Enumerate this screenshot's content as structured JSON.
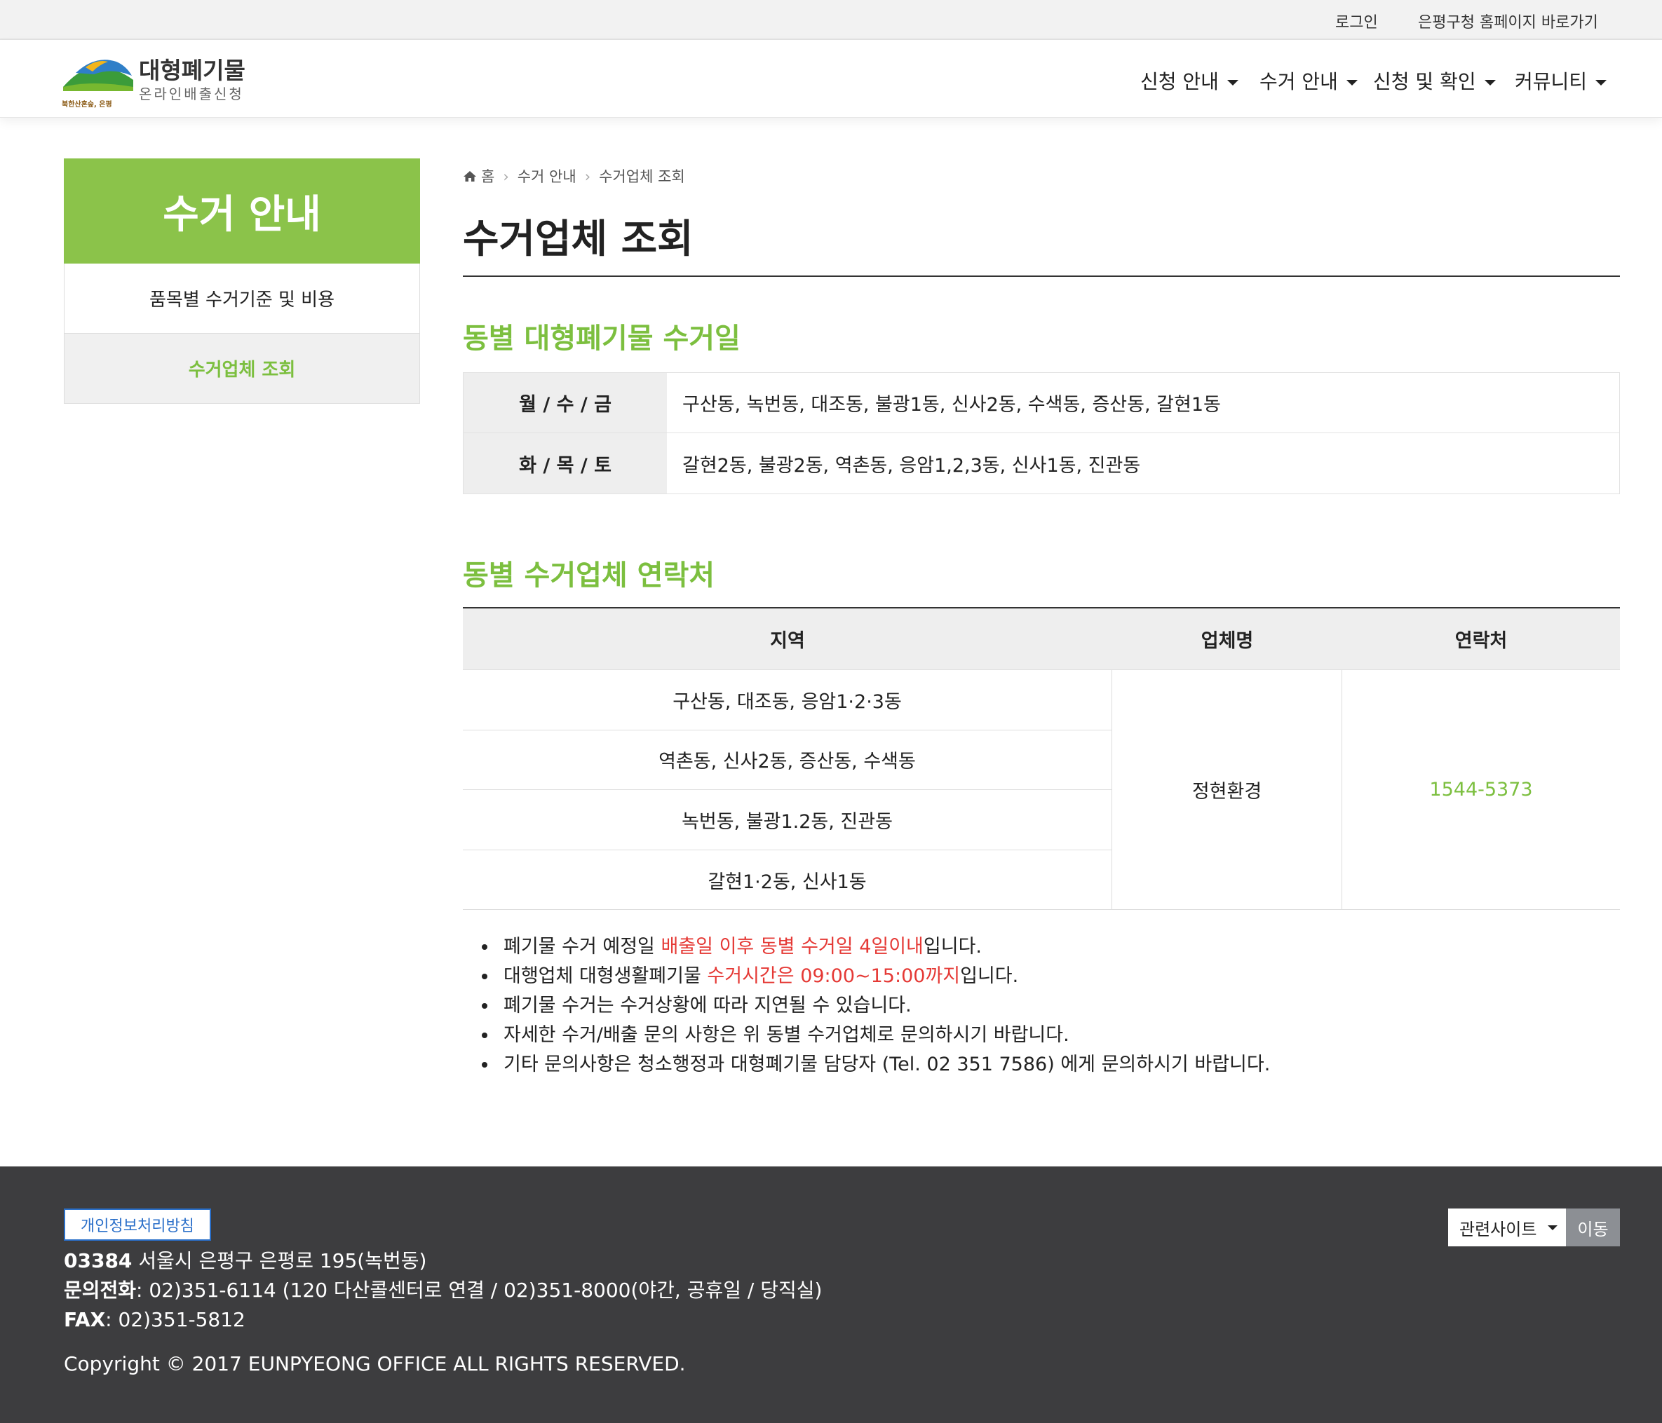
{
  "topbar": {
    "login": "로그인",
    "homepage_link": "은평구청 홈페이지 바로가기"
  },
  "header": {
    "logo_title": "대형폐기물",
    "logo_subtitle": "온라인배출신청",
    "logo_slogan": "북한산혼숲, 은평",
    "nav": [
      "신청 안내",
      "수거 안내",
      "신청 및 확인",
      "커뮤니티"
    ]
  },
  "sidebar": {
    "title": "수거 안내",
    "items": [
      "품목별 수거기준 및 비용",
      "수거업체 조회"
    ]
  },
  "breadcrumb": [
    "홈",
    "수거 안내",
    "수거업체 조회"
  ],
  "page_title": "수거업체 조회",
  "section1": {
    "title": "동별 대형폐기물 수거일",
    "rows": [
      {
        "days": "월 / 수 / 금",
        "areas": "구산동, 녹번동, 대조동, 불광1동, 신사2동, 수색동, 증산동, 갈현1동"
      },
      {
        "days": "화 / 목 / 토",
        "areas": "갈현2동, 불광2동, 역촌동, 응암1,2,3동, 신사1동, 진관동"
      }
    ]
  },
  "section2": {
    "title": "동별 수거업체 연락처",
    "headers": [
      "지역",
      "업체명",
      "연락처"
    ],
    "regions": [
      "구산동, 대조동, 응암1·2·3동",
      "역촌동, 신사2동, 증산동, 수색동",
      "녹번동, 불광1.2동, 진관동",
      "갈현1·2동, 신사1동"
    ],
    "company": "정현환경",
    "phone": "1544-5373"
  },
  "notes": {
    "n1_a": "폐기물 수거 예정일 ",
    "n1_red": "배출일 이후 동별 수거일 4일이내",
    "n1_b": "입니다.",
    "n2_a": "대행업체 대형생활폐기물 ",
    "n2_red": "수거시간은 09:00~15:00까지",
    "n2_b": "입니다.",
    "n3": "폐기물 수거는 수거상황에 따라 지연될 수 있습니다.",
    "n4": "자세한 수거/배출 문의 사항은 위 동별 수거업체로 문의하시기 바랍니다.",
    "n5": "기타 문의사항은 청소행정과 대형폐기물 담당자 (Tel. 02 351 7586) 에게 문의하시기 바랍니다."
  },
  "footer": {
    "privacy": "개인정보처리방침",
    "zip": "03384",
    "address": " 서울시 은평구 은평로 195(녹번동)",
    "phone_label": "문의전화",
    "phone": ": 02)351-6114 (120 다산콜센터로 연결 / 02)351-8000(야간, 공휴일 / 당직실)",
    "fax_label": "FAX",
    "fax": ": 02)351-5812",
    "copyright": "Copyright © 2017 EUNPYEONG OFFICE ALL RIGHTS RESERVED.",
    "related_sites": "관련사이트",
    "go": "이동"
  },
  "colors": {
    "accent_green": "#8bc34a",
    "text_green": "#7cbf3f",
    "alert_red": "#e53935",
    "footer_bg": "#3d3d3f"
  }
}
